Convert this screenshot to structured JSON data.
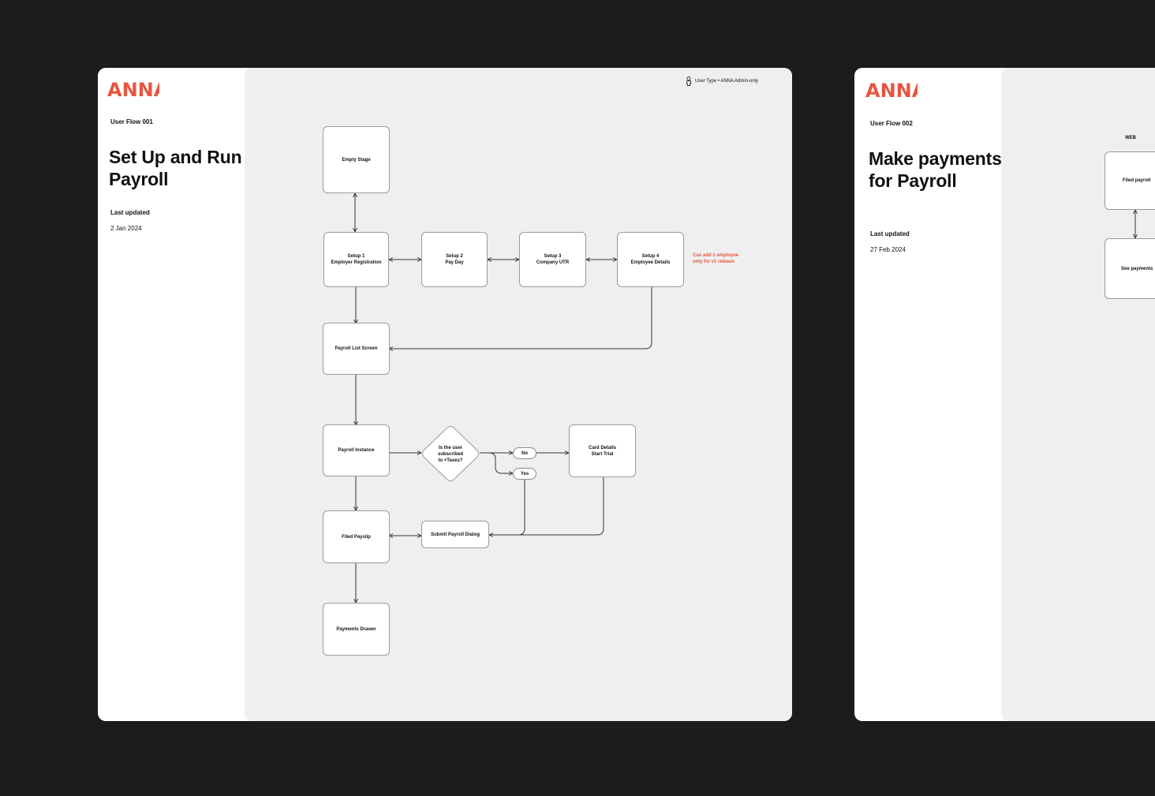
{
  "colors": {
    "background": "#1c1c1c",
    "board": "#ffffff",
    "canvas": "#efefef",
    "brand": "#e8553f",
    "note": "#e8553f",
    "line": "#333333"
  },
  "boards": [
    {
      "logo": "ANNA",
      "flow_id": "User Flow 001",
      "title": "Set Up and Run Payroll",
      "last_updated_label": "Last updated",
      "last_updated_value": "2 Jan 2024",
      "user_type": {
        "icon": "person-icon",
        "text": "User Type • ANNA Admin-only"
      },
      "nodes": {
        "empty_stage": "Empty Stage",
        "setup1": "Setup 1\nEmployer Registration",
        "setup2": "Setup 2\nPay Day",
        "setup3": "Setup 3\nCompany UTR",
        "setup4": "Setup 4\nEmployee Details",
        "payroll_list": "Payroll List Screen",
        "payroll_instance": "Payroll Instance",
        "decision": "Is the user\nsubscribed\nto +Taxes?",
        "no": "No",
        "yes": "Yes",
        "card_details": "Card Details\nStart Trial",
        "submit_dialog": "Submit Payroll Dialog",
        "filed_payslip": "Filed Payslip",
        "payments_drawer": "Payments Drawer"
      },
      "note": "Can add 1 employee\nonly for v1 release"
    },
    {
      "logo": "ANNA",
      "flow_id": "User Flow 002",
      "title": "Make payments for Payroll",
      "last_updated_label": "Last updated",
      "last_updated_value": "27 Feb 2024",
      "platform": "WEB",
      "nodes": {
        "filed_payroll": "Filed payroll",
        "see_payments": "See payments"
      }
    }
  ]
}
